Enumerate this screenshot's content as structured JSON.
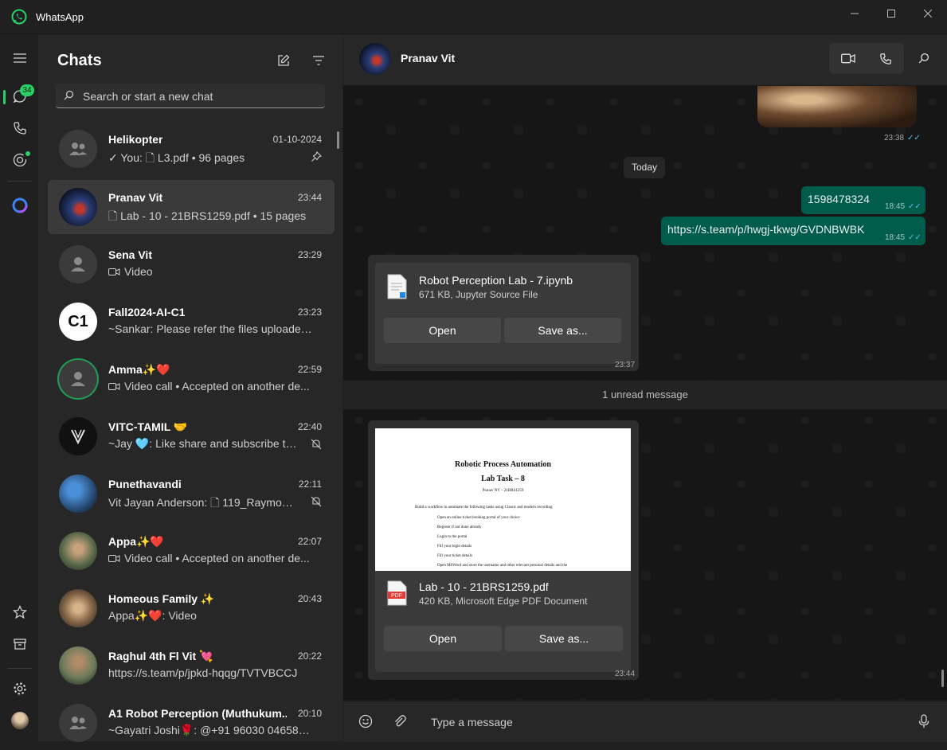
{
  "app": {
    "title": "WhatsApp",
    "accent": "#25d366"
  },
  "rail": {
    "unread_badge": "34"
  },
  "panel": {
    "title": "Chats",
    "search_placeholder": "Search or start a new chat",
    "chats": [
      {
        "name": "Helikopter",
        "time": "01-10-2024",
        "preview": "✓ You: 🗋 L3.pdf • 96 pages",
        "flag": "pin-icon"
      },
      {
        "name": "Pranav Vit",
        "time": "23:44",
        "preview": "🗋 Lab - 10 - 21BRS1259.pdf • 15 pages",
        "flag": ""
      },
      {
        "name": "Sena Vit",
        "time": "23:29",
        "preview": "Video",
        "flag": ""
      },
      {
        "name": "Fall2024-AI-C1",
        "time": "23:23",
        "preview": "~Sankar: Please refer the files uploaded...",
        "flag": "",
        "avatar_text": "C1"
      },
      {
        "name": "Amma✨❤️",
        "time": "22:59",
        "preview": "Video call • Accepted on another de...",
        "flag": ""
      },
      {
        "name": "VITC-TAMIL 🤝",
        "time": "22:40",
        "preview": "~Jay 🩵: Like share and subscribe to V...",
        "flag": "mute-icon"
      },
      {
        "name": "Punethavandi",
        "time": "22:11",
        "preview": "Vit Jayan Anderson: 🗋 119_Raymond...",
        "flag": "mute-icon"
      },
      {
        "name": "Appa✨❤️",
        "time": "22:07",
        "preview": "Video call • Accepted on another de...",
        "flag": ""
      },
      {
        "name": "Homeous Family ✨",
        "time": "20:43",
        "preview": "Appa✨❤️: Video",
        "flag": ""
      },
      {
        "name": "Raghul 4th Fl Vit 💘",
        "time": "20:22",
        "preview": "https://s.team/p/jpkd-hqqg/TVTVBCCJ",
        "flag": ""
      },
      {
        "name": "A1 Robot Perception (Muthukum...",
        "time": "20:10",
        "preview": "~Gayatri Joshi🌹: @+91 96030 04658 si...",
        "flag": ""
      }
    ]
  },
  "conversation": {
    "contact_name": "Pranav Vit",
    "image_time": "23:38",
    "date_divider": "Today",
    "messages_out": [
      {
        "text": "1598478324",
        "time": "18:45"
      },
      {
        "text": "https://s.team/p/hwgj-tkwg/GVDNBWBK",
        "time": "18:45"
      }
    ],
    "file1": {
      "name": "Robot Perception Lab - 7.ipynb",
      "meta": "671 KB, Jupyter Source File",
      "open": "Open",
      "save": "Save as...",
      "time": "23:37"
    },
    "unread": "1 unread message",
    "file2": {
      "name": "Lab - 10 - 21BRS1259.pdf",
      "meta": "420 KB, Microsoft Edge PDF Document",
      "open": "Open",
      "save": "Save as...",
      "time": "23:44",
      "preview": {
        "title": "Robotic Process Automation",
        "subtitle": "Lab Task – 8",
        "author": "Pranav NV – 21BRS1259",
        "lines": [
          "Build a workflow to automate the following tasks using Classic and modern recording",
          "Open an online ticket booking portal of your choice",
          "Register if not done already",
          "Login to the portal",
          "Fill your login details",
          "Fill your ticket details",
          "Open MSWord and store the username and other relevant personal details and the"
        ]
      }
    },
    "input_placeholder": "Type a message"
  }
}
